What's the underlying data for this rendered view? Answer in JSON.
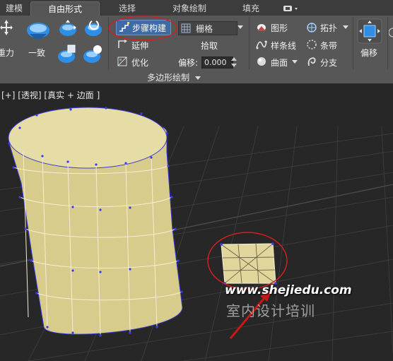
{
  "tabs": [
    {
      "label": "建模",
      "active": false
    },
    {
      "label": "自由形式",
      "active": true
    },
    {
      "label": "选择",
      "active": false
    },
    {
      "label": "对象绘制",
      "active": false
    },
    {
      "label": "填充",
      "active": false
    }
  ],
  "ribbon": {
    "left_cut_label": "重力",
    "conform_label": "一致",
    "step_build_label": "步骤构建",
    "extend_label": "延伸",
    "optimize_label": "优化",
    "grid_label": "栅格",
    "pick_label": "拾取",
    "offset_label": "偏移:",
    "offset_value": "0.000",
    "shapes_label": "图形",
    "splines_label": "样条线",
    "surface_label": "曲面",
    "topology_label": "拓扑",
    "strips_label": "条带",
    "branches_label": "分支",
    "offset_big_label": "偏移",
    "group_footer": "多边形绘制",
    "accent_color": "#3e6aa6"
  },
  "viewport": {
    "label": "[+] [透视] [真实 + 边面 ]",
    "object_color": "#e0d59a",
    "vertex_color": "#3a3aff",
    "annotation_color": "#d02020"
  },
  "watermark": {
    "url": "www.shejiedu.com",
    "text": "室内设计培训"
  }
}
